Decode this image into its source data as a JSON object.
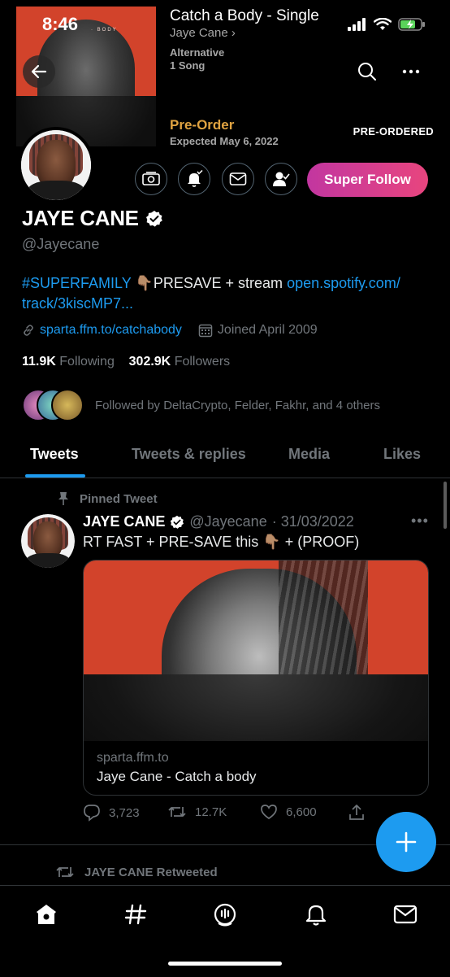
{
  "status_bar": {
    "time": "8:46"
  },
  "banner": {
    "tag": "· BODY"
  },
  "album": {
    "title": "Catch a Body - Single",
    "artist": "Jaye Cane",
    "genre": "Alternative",
    "song_count": "1 Song",
    "preorder_label": "Pre-Order",
    "expected": "Expected May 6, 2022",
    "preordered_badge": "PRE-ORDERED"
  },
  "profile": {
    "name": "JAYE CANE",
    "handle": "@Jayecane",
    "super_follow_label": "Super Follow",
    "bio": {
      "hashtag": "#SUPERFAMILY",
      "emoji": "👇🏽",
      "text": "PRESAVE + stream",
      "link_part1": "open.spotify.com/",
      "link_part2": "track/3kiscMP7..."
    },
    "website": "sparta.ffm.to/catchabody",
    "joined": "Joined April 2009",
    "following_count": "11.9K",
    "following_label": "Following",
    "followers_count": "302.9K",
    "followers_label": "Followers",
    "followed_by": "Followed by DeltaCrypto, Felder, Fakhr, and 4 others"
  },
  "tabs": [
    {
      "label": "Tweets"
    },
    {
      "label": "Tweets & replies"
    },
    {
      "label": "Media"
    },
    {
      "label": "Likes"
    }
  ],
  "pinned_tweet": {
    "pinned_label": "Pinned Tweet",
    "author": "JAYE CANE",
    "handle": "@Jayecane",
    "date": "· 31/03/2022",
    "text_before": "RT FAST + PRE-SAVE this",
    "emoji": "👇🏽",
    "text_after": "+ (PROOF)",
    "card_domain": "sparta.ffm.to",
    "card_title": "Jaye Cane - Catch a body",
    "replies": "3,723",
    "retweets": "12.7K",
    "likes": "6,600"
  },
  "next_item": {
    "retweeted_label": "JAYE CANE Retweeted"
  },
  "colors": {
    "accent": "#1d9bf0",
    "preorder": "#e0a341",
    "banner_red": "#d2432b",
    "super_follow_start": "#c236a0",
    "super_follow_end": "#e8457e"
  },
  "icons": {
    "back": "arrow-left-icon",
    "search": "search-icon",
    "more": "more-icon",
    "tip": "tip-jar-icon",
    "bell": "bell-icon",
    "mail": "mail-icon",
    "following": "following-icon",
    "verified": "verified-icon",
    "link": "link-icon",
    "calendar": "calendar-icon",
    "pin": "pin-icon",
    "reply": "reply-icon",
    "retweet": "retweet-icon",
    "like": "heart-icon",
    "share": "share-icon",
    "compose": "plus-icon"
  }
}
